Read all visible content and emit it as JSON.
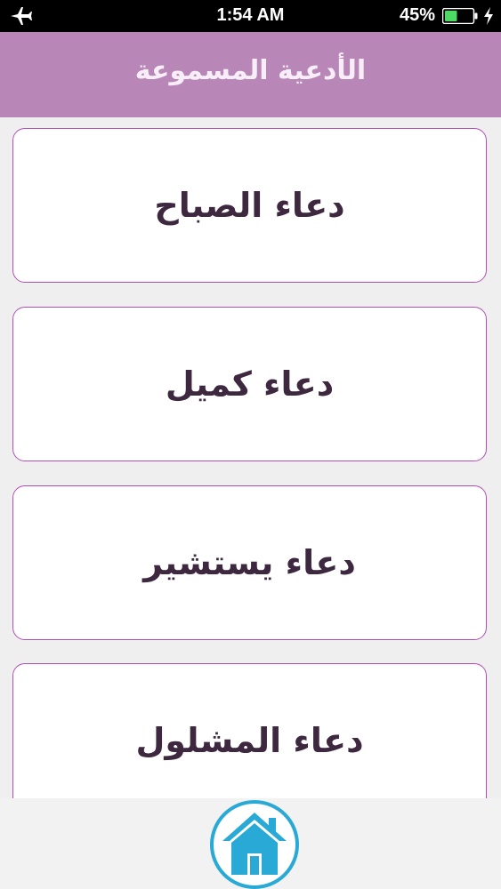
{
  "status_bar": {
    "time": "1:54 AM",
    "battery_percent": "45%",
    "battery_level": 0.45,
    "icons": [
      "airplane-icon",
      "battery-icon",
      "charging-bolt-icon"
    ]
  },
  "nav": {
    "title": "الأدعية المسموعة"
  },
  "items": [
    {
      "label": "دعاء الصباح"
    },
    {
      "label": "دعاء كميل"
    },
    {
      "label": "دعاء يستشير"
    },
    {
      "label": "دعاء المشلول"
    }
  ],
  "bottom": {
    "home_icon": "home-icon"
  },
  "colors": {
    "nav_background": "#b886b7",
    "card_border": "#b050b5",
    "card_text": "#3d2840",
    "home_accent": "#29a9d6",
    "battery_green": "#4cd964"
  }
}
